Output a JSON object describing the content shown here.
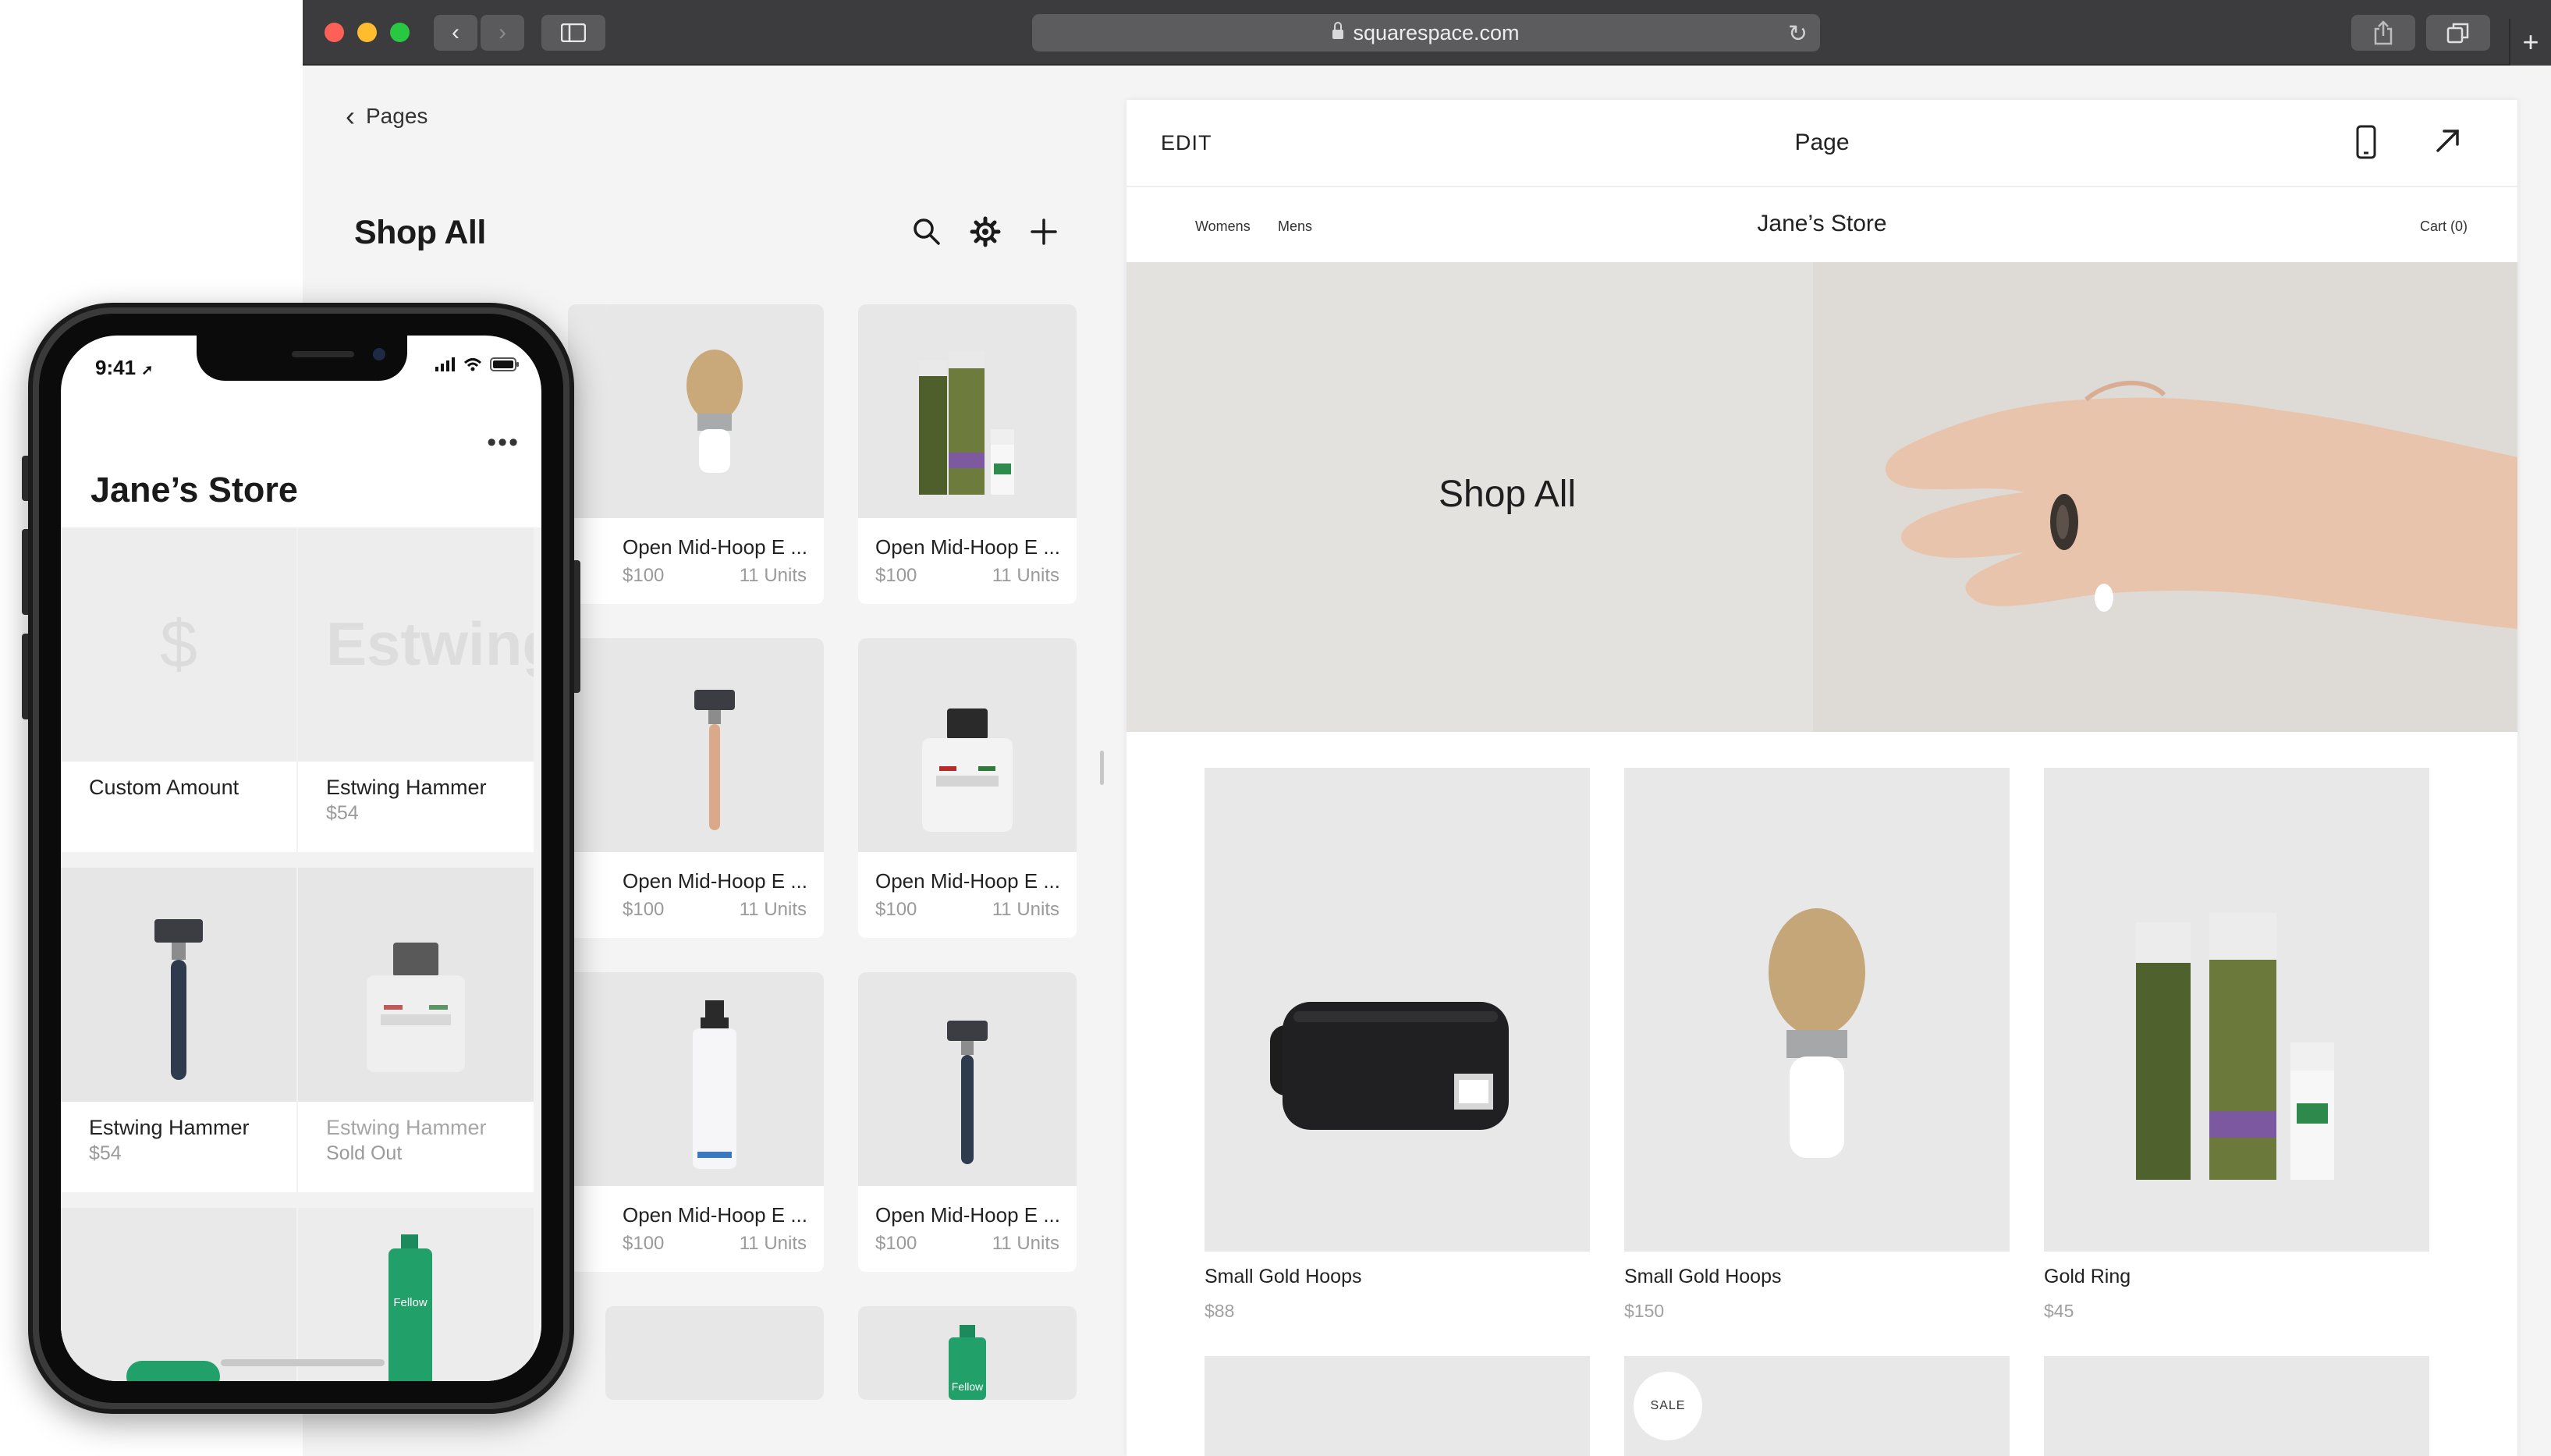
{
  "browser": {
    "url": "squarespace.com",
    "traffic_colors": [
      "#fe5f57",
      "#febc2e",
      "#28c840"
    ]
  },
  "left_panel": {
    "back_label": "Pages",
    "title": "Shop All",
    "products": [
      {
        "name": "Open Mid-Hoop E ...",
        "price": "$100",
        "units": "11 Units",
        "icon": "shaving-brush"
      },
      {
        "name": "Open Mid-Hoop E ...",
        "price": "$100",
        "units": "11 Units",
        "icon": "bottles"
      },
      {
        "name": "Open Mid-Hoop E ...",
        "price": "$100",
        "units": "11 Units",
        "icon": "razor-gold"
      },
      {
        "name": "Open Mid-Hoop E ...",
        "price": "$100",
        "units": "11 Units",
        "icon": "proraso-jar"
      },
      {
        "name": "Open Mid-Hoop E ...",
        "price": "$100",
        "units": "11 Units",
        "icon": "pump-bottle"
      },
      {
        "name": "Open Mid-Hoop E ...",
        "price": "$100",
        "units": "11 Units",
        "icon": "razor-blue"
      }
    ],
    "partial_label": "Fellow"
  },
  "preview": {
    "edit_label": "EDIT",
    "page_label": "Page",
    "nav": [
      "Womens",
      "Mens"
    ],
    "store_name": "Jane’s Store",
    "cart_label": "Cart (0)",
    "hero_title": "Shop All",
    "products": [
      {
        "name": "Small Gold Hoops",
        "price": "$88",
        "icon": "toiletry-bag"
      },
      {
        "name": "Small Gold Hoops",
        "price": "$150",
        "icon": "shaving-brush"
      },
      {
        "name": "Gold Ring",
        "price": "$45",
        "icon": "bottles"
      }
    ],
    "sale_badge": "SALE"
  },
  "phone": {
    "time": "9:41",
    "app_title": "Jane’s Store",
    "more_label": "•••",
    "tiles": [
      {
        "name": "Custom Amount",
        "price": "",
        "thumb_text": "$"
      },
      {
        "name": "Estwing Hammer",
        "price": "$54",
        "thumb_text": "Estwing"
      },
      {
        "name": "Estwing Hammer",
        "price": "$54",
        "thumb_text": ""
      },
      {
        "name": "Estwing Hammer",
        "price": "Sold Out",
        "thumb_text": ""
      }
    ],
    "partial_label": "Fellow"
  }
}
